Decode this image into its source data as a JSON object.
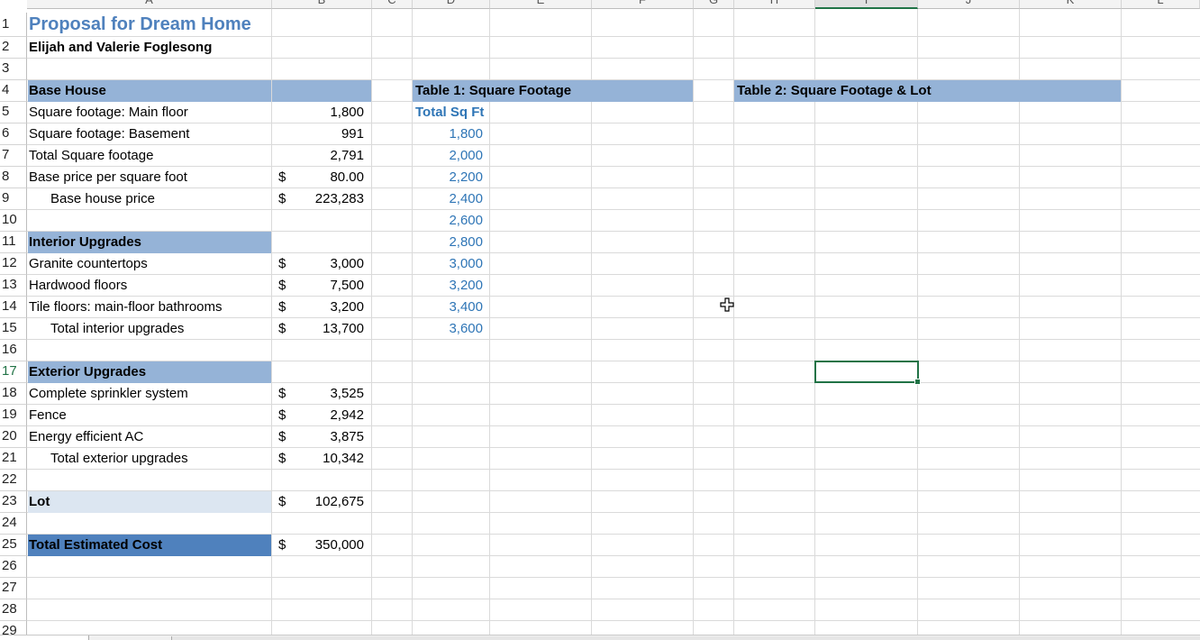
{
  "columns": [
    "A",
    "B",
    "C",
    "D",
    "E",
    "F",
    "G",
    "H",
    "I",
    "J",
    "K",
    "L"
  ],
  "rows": [
    "1",
    "2",
    "3",
    "4",
    "5",
    "6",
    "7",
    "8",
    "9",
    "10",
    "11",
    "12",
    "13",
    "14",
    "15",
    "16",
    "17",
    "18",
    "19",
    "20",
    "21",
    "22",
    "23",
    "24",
    "25",
    "26",
    "27",
    "28",
    "29"
  ],
  "title": "Proposal for Dream Home",
  "subtitle": "Elijah and Valerie Foglesong",
  "base_house": {
    "header": "Base House",
    "main_floor_label": "Square footage: Main floor",
    "main_floor_value": "1,800",
    "basement_label": "Square footage: Basement",
    "basement_value": "991",
    "total_sqft_label": "Total Square footage",
    "total_sqft_value": "2,791",
    "price_per_sqft_label": "Base price per square foot",
    "price_per_sqft_currency": "$",
    "price_per_sqft_value": "80.00",
    "base_price_label": "Base house price",
    "base_price_currency": "$",
    "base_price_value": "223,283"
  },
  "interior": {
    "header": "Interior Upgrades",
    "items": [
      {
        "label": "Granite countertops",
        "currency": "$",
        "value": "3,000"
      },
      {
        "label": "Hardwood floors",
        "currency": "$",
        "value": "7,500"
      },
      {
        "label": "Tile floors: main-floor bathrooms",
        "currency": "$",
        "value": "3,200"
      }
    ],
    "total_label": "Total interior upgrades",
    "total_currency": "$",
    "total_value": "13,700"
  },
  "exterior": {
    "header": "Exterior Upgrades",
    "items": [
      {
        "label": "Complete sprinkler system",
        "currency": "$",
        "value": "3,525"
      },
      {
        "label": "Fence",
        "currency": "$",
        "value": "2,942"
      },
      {
        "label": "Energy efficient AC",
        "currency": "$",
        "value": "3,875"
      }
    ],
    "total_label": "Total exterior upgrades",
    "total_currency": "$",
    "total_value": "10,342"
  },
  "lot": {
    "label": "Lot",
    "currency": "$",
    "value": "102,675"
  },
  "total_cost": {
    "label": "Total Estimated Cost",
    "currency": "$",
    "value": "350,000"
  },
  "table1": {
    "title": "Table 1: Square Footage",
    "column_header": "Total Sq Ft",
    "values": [
      "1,800",
      "2,000",
      "2,200",
      "2,400",
      "2,600",
      "2,800",
      "3,000",
      "3,200",
      "3,400",
      "3,600"
    ]
  },
  "table2": {
    "title": "Table 2: Square Footage & Lot"
  },
  "selected_cell": "I17",
  "colors": {
    "band_blue": "#95b3d7",
    "lot_band": "#dce6f1",
    "total_band": "#4f81bd",
    "title_blue": "#4f81bd",
    "accent_green": "#217346"
  }
}
